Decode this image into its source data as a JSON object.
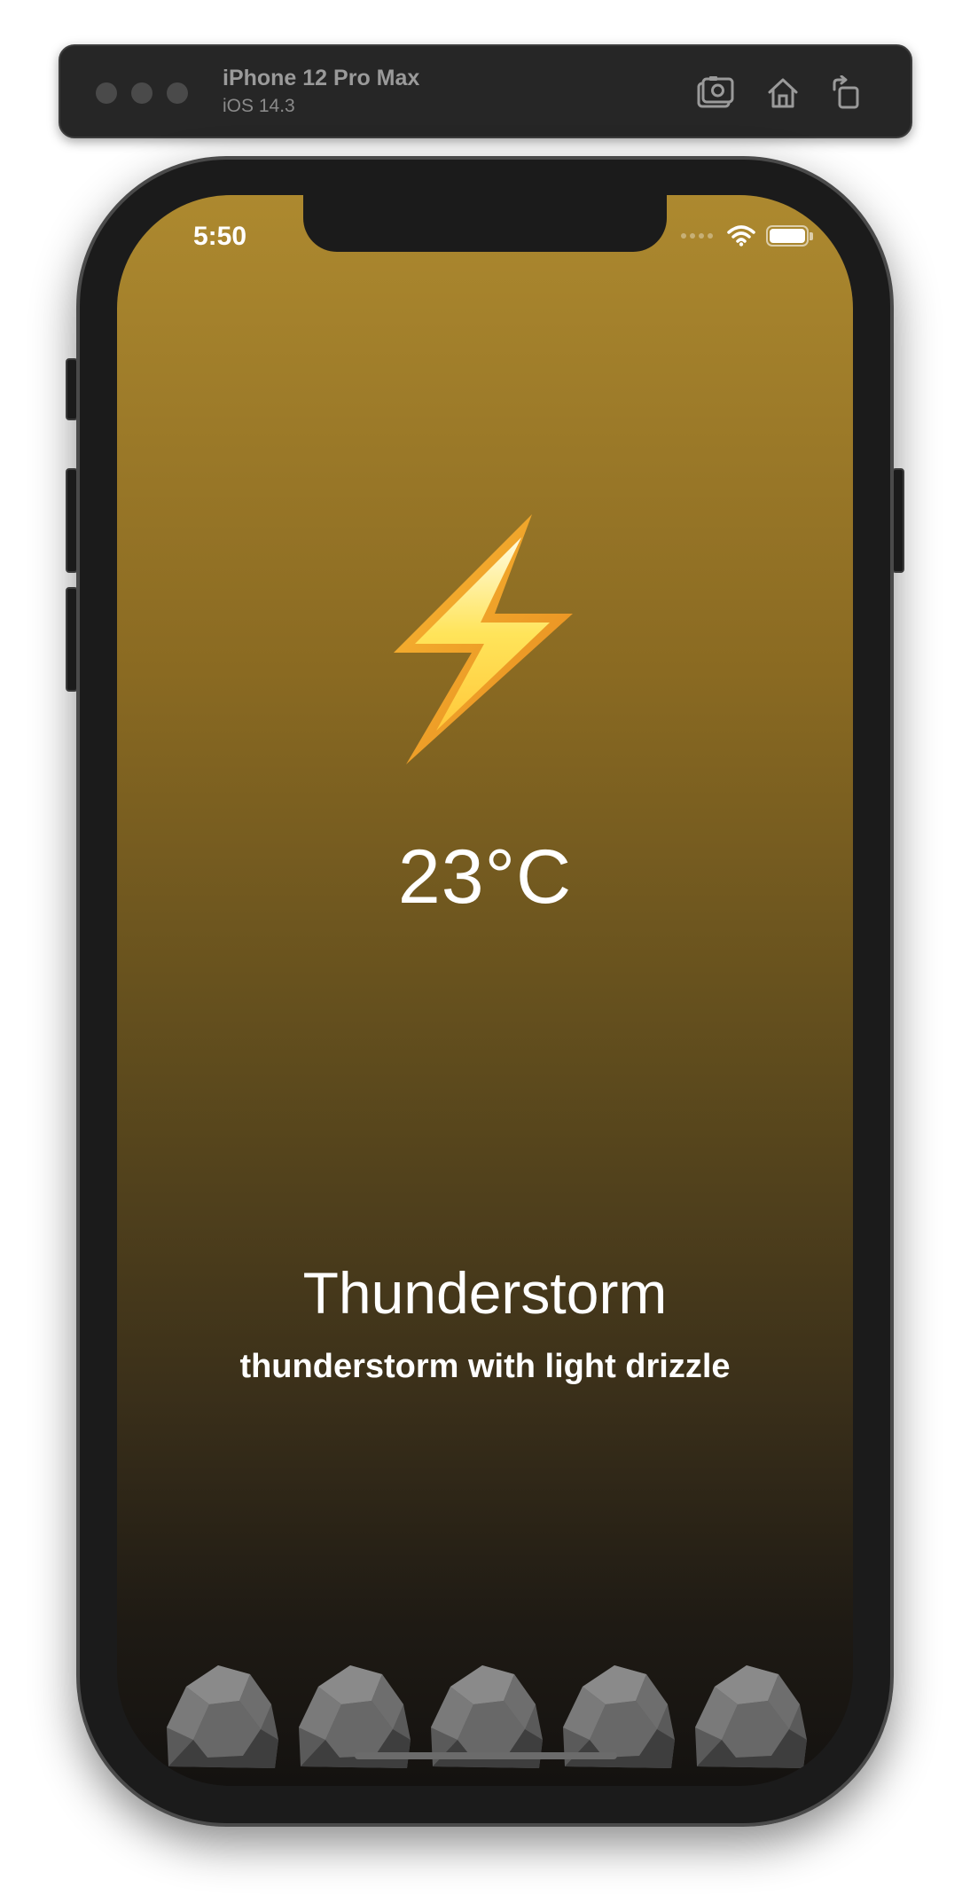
{
  "simulator": {
    "device_name": "iPhone 12 Pro Max",
    "os_version": "iOS 14.3",
    "buttons": [
      "screenshot-icon",
      "home-icon",
      "rotate-icon"
    ]
  },
  "status_bar": {
    "time": "5:50",
    "icons": [
      "signal-icon",
      "wifi-icon",
      "battery-icon"
    ]
  },
  "weather": {
    "icon": "lightning-bolt-icon",
    "temperature": "23°C",
    "condition": "Thunderstorm",
    "description": "thunderstorm with light drizzle",
    "forecast_icons": [
      "rock-icon",
      "rock-icon",
      "rock-icon",
      "rock-icon",
      "rock-icon"
    ]
  },
  "colors": {
    "gradient_top": "#ad892f",
    "gradient_bottom": "#141210",
    "text": "#ffffff"
  }
}
